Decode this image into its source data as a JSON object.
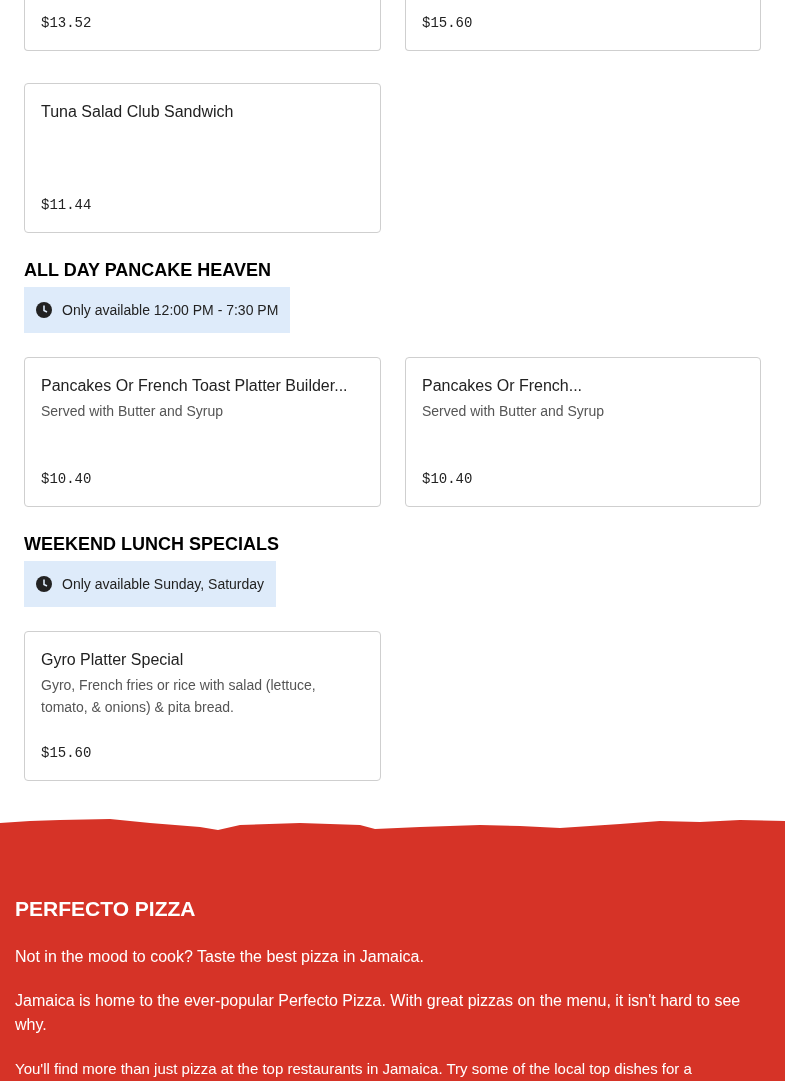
{
  "top_items": [
    {
      "price": "$13.52"
    },
    {
      "price": "$15.60"
    }
  ],
  "items": [
    {
      "name": "Tuna Salad Club Sandwich",
      "price": "$11.44"
    }
  ],
  "sections": [
    {
      "title": "ALL DAY PANCAKE HEAVEN",
      "availability": "Only available 12:00 PM - 7:30 PM",
      "items": [
        {
          "name": "Pancakes Or French Toast Platter Builder...",
          "description": "Served with Butter and Syrup",
          "price": "$10.40"
        },
        {
          "name": "Pancakes Or French...",
          "description": "Served with Butter and Syrup",
          "price": "$10.40"
        }
      ]
    },
    {
      "title": "WEEKEND LUNCH SPECIALS",
      "availability": "Only available Sunday, Saturday",
      "items": [
        {
          "name": "Gyro Platter Special",
          "description": "Gyro, French fries or rice with salad (lettuce, tomato, & onions) & pita bread.",
          "price": "$15.60"
        }
      ]
    }
  ],
  "footer": {
    "title": "PERFECTO PIZZA",
    "paragraphs": [
      "Not in the mood to cook? Taste the best pizza in Jamaica.",
      "Jamaica is home to the ever-popular Perfecto Pizza. With great pizzas on the menu, it isn't hard to see why.",
      "You'll find more than just pizza at the top restaurants in Jamaica. Try some of the local top dishes for a"
    ]
  }
}
